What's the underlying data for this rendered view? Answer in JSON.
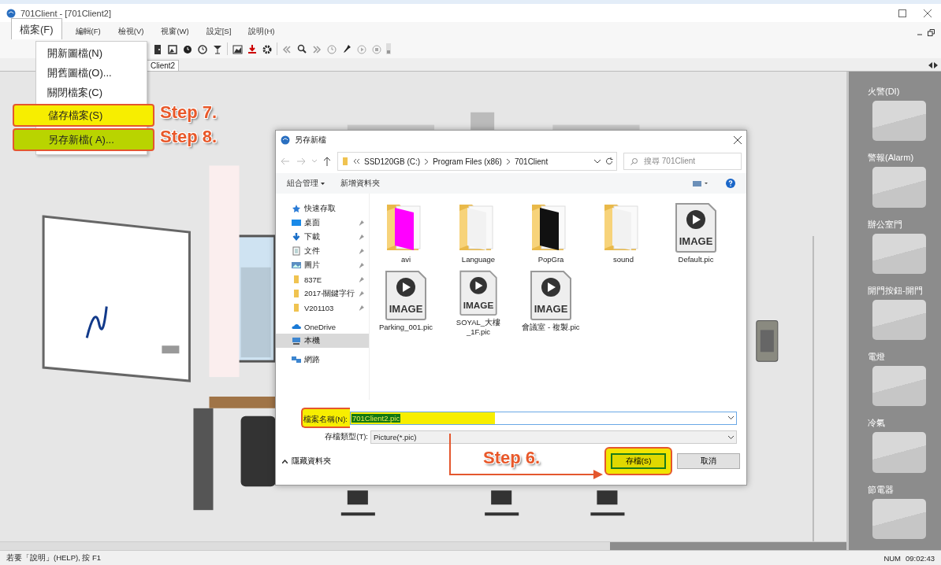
{
  "window": {
    "title": "701Client - [701Client2]"
  },
  "menubar": {
    "items": [
      {
        "label": "檔案(F)",
        "selected": true
      },
      {
        "label": "編輯(F)",
        "selected": false
      },
      {
        "label": "檢視(V)",
        "selected": false
      },
      {
        "label": "視窗(W)",
        "selected": false
      },
      {
        "label": "設定[S]",
        "selected": false
      },
      {
        "label": "說明(H)",
        "selected": false
      }
    ]
  },
  "tabs": [
    {
      "label": "Client2",
      "selected": true
    }
  ],
  "file_menu": {
    "items": [
      {
        "label": "開新圖檔(N)",
        "highlighted": false
      },
      {
        "label": "開舊圖檔(O)...",
        "highlighted": false
      },
      {
        "label": "關閉檔案(C)",
        "highlighted": false
      },
      {
        "label": "儲存檔案(S)",
        "highlighted": true,
        "color": "#f7ee00",
        "step": "Step 7."
      },
      {
        "label": "另存新檔( A)...",
        "highlighted": true,
        "color": "#b9d400",
        "step": "Step 8."
      }
    ]
  },
  "side_panel": {
    "tiles": [
      "火警(DI)",
      "警報(Alarm)",
      "辦公室門",
      "開門按鈕-開門",
      "電燈",
      "冷氣",
      "節電器"
    ]
  },
  "dialog": {
    "title": "另存新檔",
    "breadcrumbs": [
      "SSD120GB (C:)",
      "Program Files (x86)",
      "701Client"
    ],
    "search": {
      "placeholder": "搜尋 701Client"
    },
    "toolbar": [
      "組合管理",
      "新增資料夾"
    ],
    "nav": [
      {
        "label": "快速存取",
        "kind": "star",
        "pinned": false,
        "selected": false
      },
      {
        "label": "桌面",
        "kind": "desktop",
        "pinned": true,
        "selected": false
      },
      {
        "label": "下載",
        "kind": "download",
        "pinned": true,
        "selected": false
      },
      {
        "label": "文件",
        "kind": "document",
        "pinned": true,
        "selected": false
      },
      {
        "label": "圖片",
        "kind": "picture",
        "pinned": true,
        "selected": false
      },
      {
        "label": "837E",
        "kind": "folder",
        "pinned": true,
        "selected": false
      },
      {
        "label": "2017-關鍵字行",
        "kind": "folder",
        "pinned": true,
        "selected": false
      },
      {
        "label": "V201103",
        "kind": "folder",
        "pinned": true,
        "selected": false
      },
      {
        "label": "OneDrive",
        "kind": "cloud",
        "pinned": false,
        "selected": false
      },
      {
        "label": "本機",
        "kind": "computer",
        "pinned": false,
        "selected": true
      },
      {
        "label": "網路",
        "kind": "network",
        "pinned": false,
        "selected": false
      }
    ],
    "files": [
      {
        "name": "avi",
        "kind": "folder",
        "color": "#ff00ff"
      },
      {
        "name": "Language",
        "kind": "folder",
        "color": "#f2f2f2"
      },
      {
        "name": "PopGra",
        "kind": "folder",
        "color": "#111111"
      },
      {
        "name": "sound",
        "kind": "folder",
        "color": "#f2f2f2"
      },
      {
        "name": "Default.pic",
        "kind": "image",
        "badge": "IMAGE"
      },
      {
        "name": "Parking_001.pic",
        "kind": "image",
        "badge": "IMAGE"
      },
      {
        "name": "SOYAL_大樓_1F.pic",
        "kind": "image",
        "badge": "IMAGE"
      },
      {
        "name": "會議室 - 複製.pic",
        "kind": "image",
        "badge": "IMAGE"
      }
    ],
    "filename": {
      "label": "檔案名稱(N):",
      "value": "701Client2.pic",
      "step": "Step 6."
    },
    "filetype": {
      "label": "存檔類型(T):",
      "value": "Picture(*.pic)"
    },
    "hide_folders": "隱藏資料夾",
    "buttons": [
      {
        "label": "存檔(S)",
        "default": true
      },
      {
        "label": "取消",
        "default": false
      }
    ]
  },
  "status_bar": {
    "text": "若要「說明」(HELP), 按 F1",
    "indicator": "NUM",
    "time": "09:02:43"
  }
}
